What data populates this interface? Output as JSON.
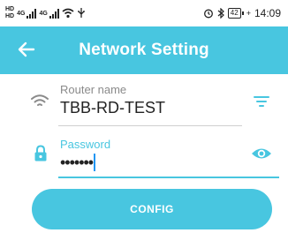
{
  "status_bar": {
    "sim_labels": [
      "HD",
      "HD"
    ],
    "network_labels": [
      "4G",
      "4G"
    ],
    "battery_level": "42",
    "time": "14:09"
  },
  "app_bar": {
    "title": "Network Setting",
    "back_icon": "arrow-left-icon",
    "background": "#48c6e0"
  },
  "router_field": {
    "label": "Router name",
    "value": "TBB-RD-TEST",
    "leading_icon": "wifi-icon",
    "trailing_icon": "filter-list-icon"
  },
  "password_field": {
    "label": "Password",
    "value": "•••••••",
    "leading_icon": "lock-icon",
    "trailing_icon": "eye-icon",
    "focused": true,
    "accent": "#48c6e0"
  },
  "config_button": {
    "label": "CONFIG",
    "color": "#48c6e0"
  }
}
